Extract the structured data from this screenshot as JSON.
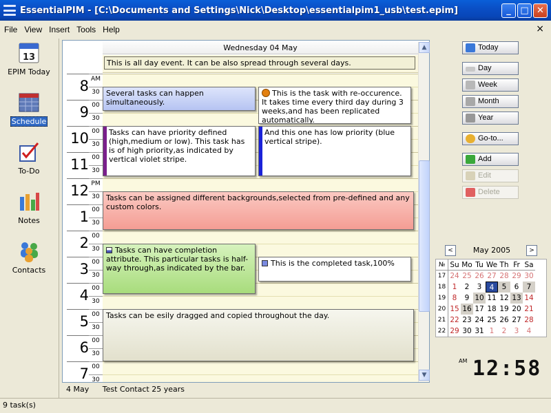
{
  "window": {
    "title": "EssentialPIM - [C:\\Documents and Settings\\Nick\\Desktop\\essentialpim1_usb\\test.epim]"
  },
  "menu": {
    "items": [
      "File",
      "View",
      "Insert",
      "Tools",
      "Help"
    ],
    "close": "×"
  },
  "nav": {
    "items": [
      {
        "label": "EPIM Today",
        "icon": "calendar-today-icon"
      },
      {
        "label": "Schedule",
        "icon": "schedule-icon"
      },
      {
        "label": "To-Do",
        "icon": "todo-icon"
      },
      {
        "label": "Notes",
        "icon": "notes-icon"
      },
      {
        "label": "Contacts",
        "icon": "contacts-icon"
      }
    ],
    "active": "Schedule"
  },
  "schedule": {
    "day_header": "Wednesday 04 May",
    "allday_event": "This is all day event. It can be also spread through several days.",
    "hours": [
      "8",
      "9",
      "10",
      "11",
      "12",
      "1",
      "2",
      "3",
      "4",
      "5",
      "6",
      "7"
    ],
    "half_labels": [
      "AM",
      "30",
      "00",
      "30",
      "00",
      "30",
      "00",
      "30",
      "PM",
      "30",
      "00",
      "30",
      "00",
      "30",
      "00",
      "30",
      "00",
      "30",
      "00",
      "30",
      "00",
      "30",
      "00",
      "30"
    ],
    "tasks": [
      {
        "id": "t1",
        "text": "Several tasks can happen simultaneously."
      },
      {
        "id": "t2",
        "text": "This is the task with re-occurence. It takes time every third day during 3 weeks,and has been replicated automatically."
      },
      {
        "id": "t3",
        "text": "Tasks can have priority defined (high,medium or low). This task has is of high priority,as indicated by vertical violet stripe."
      },
      {
        "id": "t4",
        "text": "And this one has low priority (blue vertical stripe)."
      },
      {
        "id": "t5",
        "text": "Tasks can be assigned  different backgrounds,selected from pre-defined and any custom colors."
      },
      {
        "id": "t6",
        "text": "Tasks can have completion attribute. This particular tasks is half-way through,as indicated by the bar."
      },
      {
        "id": "t7",
        "text": "This is the completed task,100%"
      },
      {
        "id": "t8",
        "text": "Tasks can be esily dragged and copied throughout the day."
      }
    ],
    "colors": {
      "high_priority": "#7a1f8c",
      "low_priority": "#1a22d8",
      "red_task": "#f8b6b0",
      "green_task": "#a8dc7c",
      "blue_task": "#b8c6f4"
    }
  },
  "infobar": {
    "date": "4 May",
    "contact": "Test Contact  25 years"
  },
  "right": {
    "buttons": {
      "today": "Today",
      "day": "Day",
      "week": "Week",
      "month": "Month",
      "year": "Year",
      "goto": "Go-to...",
      "add": "Add",
      "edit": "Edit",
      "delete": "Delete"
    },
    "calendar": {
      "title": "May  2005",
      "prev": "<",
      "next": ">",
      "headers": [
        "№",
        "Su",
        "Mo",
        "Tu",
        "We",
        "Th",
        "Fr",
        "Sa"
      ],
      "weeks": [
        [
          "17",
          "24",
          "25",
          "26",
          "27",
          "28",
          "29",
          "30"
        ],
        [
          "18",
          "1",
          "2",
          "3",
          "4",
          "5",
          "6",
          "7"
        ],
        [
          "19",
          "8",
          "9",
          "10",
          "11",
          "12",
          "13",
          "14"
        ],
        [
          "20",
          "15",
          "16",
          "17",
          "18",
          "19",
          "20",
          "21"
        ],
        [
          "21",
          "22",
          "23",
          "24",
          "25",
          "26",
          "27",
          "28"
        ],
        [
          "22",
          "29",
          "30",
          "31",
          "1",
          "2",
          "3",
          "4"
        ]
      ]
    },
    "clock": {
      "ampm": "AM",
      "time": "12:58"
    }
  },
  "status": {
    "text": "9 task(s)"
  }
}
